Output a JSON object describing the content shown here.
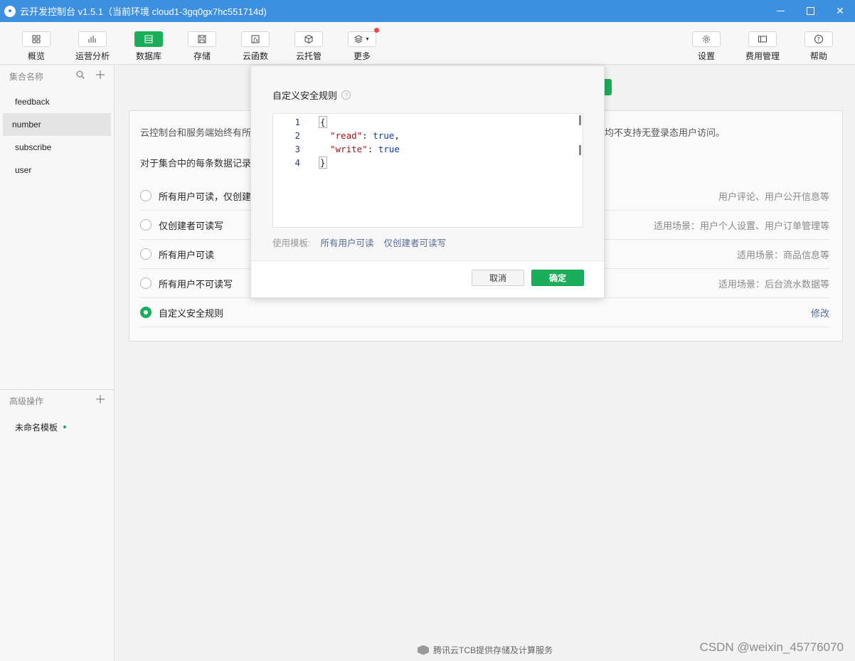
{
  "window": {
    "title": "云开发控制台 v1.5.1（当前环境 cloud1-3gq0gx7hc551714d)"
  },
  "toolbar": {
    "items": [
      {
        "label": "概览",
        "icon": "grid-icon"
      },
      {
        "label": "运营分析",
        "icon": "bar-chart-icon"
      },
      {
        "label": "数据库",
        "icon": "database-icon"
      },
      {
        "label": "存储",
        "icon": "save-icon"
      },
      {
        "label": "云函数",
        "icon": "function-icon"
      },
      {
        "label": "云托管",
        "icon": "cube-icon"
      },
      {
        "label": "更多",
        "icon": "layers-icon"
      },
      {
        "label": "设置",
        "icon": "gear-icon"
      },
      {
        "label": "费用管理",
        "icon": "billing-icon"
      },
      {
        "label": "帮助",
        "icon": "help-icon"
      }
    ]
  },
  "sidebar": {
    "header": "集合名称",
    "collections": [
      "feedback",
      "number",
      "subscribe",
      "user"
    ],
    "advanced_header": "高级操作",
    "advanced_items": [
      "未命名模板"
    ]
  },
  "panel": {
    "description": "云控制台和服务端始终有所",
    "description_tail": "均不支持无登录态用户访问。",
    "question": "对于集合中的每条数据记录",
    "options": [
      {
        "label": "所有用户可读，仅创建",
        "right": "用户评论、用户公开信息等"
      },
      {
        "label": "仅创建者可读写",
        "right": "适用场景：用户个人设置、用户订单管理等"
      },
      {
        "label": "所有用户可读",
        "right": "适用场景：商品信息等"
      },
      {
        "label": "所有用户不可读写",
        "right": "适用场景：后台流水数据等"
      },
      {
        "label": "自定义安全规则",
        "right": "修改"
      }
    ]
  },
  "modal": {
    "title": "自定义安全规则",
    "code": {
      "line_numbers": [
        "1",
        "2",
        "3",
        "4"
      ],
      "open_brace": "{",
      "read_key": "\"read\"",
      "read_val": "true",
      "write_key": "\"write\"",
      "write_val": "true",
      "close_brace": "}"
    },
    "template_label": "使用模板:",
    "template_links": [
      "所有用户可读",
      "仅创建者可读写"
    ],
    "cancel_label": "取消",
    "ok_label": "确定"
  },
  "footer": {
    "text": "腾讯云TCB提供存储及计算服务"
  },
  "watermark": "CSDN @weixin_45776070"
}
